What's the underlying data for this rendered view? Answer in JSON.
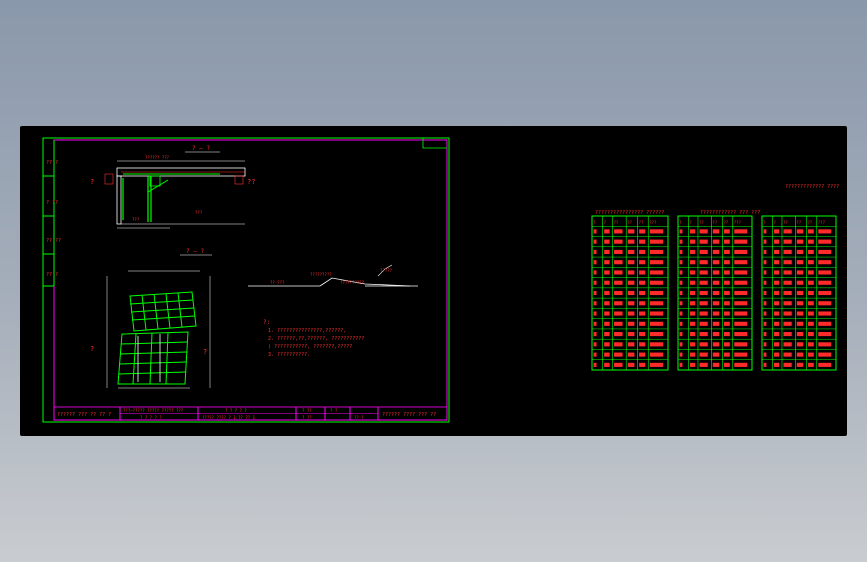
{
  "drawing": {
    "sheet_left": {
      "side_strip_cells": [
        "?? ?",
        "? ??",
        "?? ??",
        "?? ?"
      ],
      "section_a": {
        "label": "? — ?",
        "dim_top": "?????? ???",
        "left_mark": "?",
        "right_mark": "??",
        "note_left": "???",
        "note_right": "???"
      },
      "section_b": {
        "label": "? — ?",
        "left_mark": "?",
        "right_mark": "?"
      },
      "profile_labels": [
        "??·???",
        "?????????",
        "??????????",
        "?????"
      ],
      "notes_title": "?:",
      "notes": [
        "1. ???????????????,??????,",
        "2. ??????,??,??????, ???????????",
        "   ( ???????????,  ???????,?????",
        "3. ??????????."
      ],
      "title_block": {
        "cell1": "?????? ??? ?? ?? ?",
        "cell2a": "???—????? ????? ????? ???",
        "cell2b": "? ? ? ? ?",
        "cell3a": "? ? ? ? ?",
        "cell3b": "????? ???? ? 1:??  ?? 1",
        "cell4a": "? ??",
        "cell4b": "? ??",
        "cell5a": "? ?",
        "cell5b": "??-?",
        "cell6": "?????? ???? ??? ??"
      }
    },
    "sheet_right": {
      "heading": "????????????? ????",
      "table_captions": [
        "???????????????? ??????",
        "???????????? ??? ???",
        ""
      ],
      "table_headers": [
        "?",
        "?",
        "??",
        "??",
        "??",
        "???"
      ],
      "row_count": 14
    },
    "colors": {
      "red": "#ff2a2a",
      "magenta": "#ff00ff",
      "green": "#00ff00",
      "white": "#ffffff",
      "background": "#000000"
    }
  }
}
